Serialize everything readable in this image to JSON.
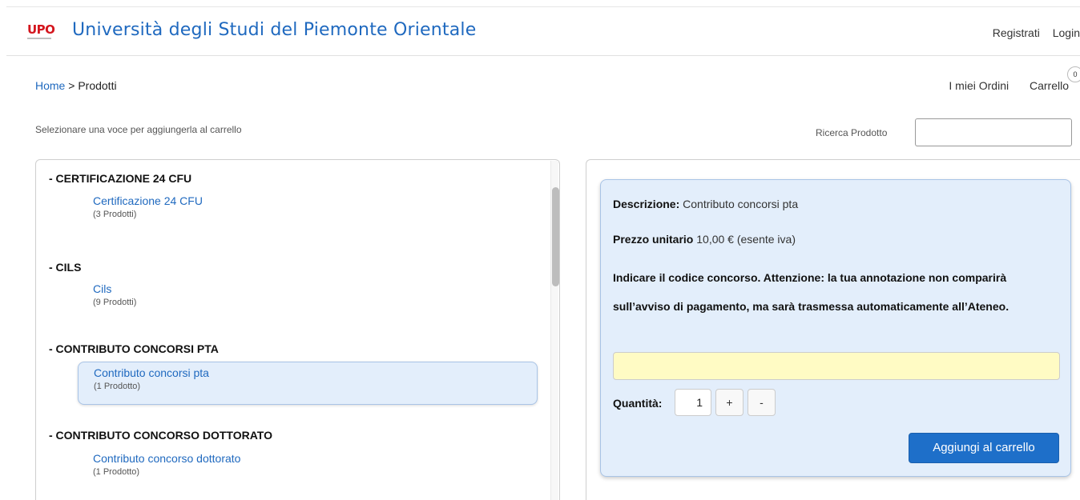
{
  "header": {
    "logo_text": "UPO",
    "site_title": "Università degli Studi del Piemonte Orientale",
    "register_label": "Registrati",
    "login_label": "Login"
  },
  "breadcrumb": {
    "home": "Home",
    "separator": " > ",
    "current": "Prodotti"
  },
  "user_nav": {
    "orders_label": "I miei Ordini",
    "cart_label": "Carrello",
    "cart_count": "0"
  },
  "instructions": "Selezionare una voce per aggiungerla al carrello",
  "search": {
    "label": "Ricerca Prodotto",
    "value": ""
  },
  "categories": [
    {
      "title": "- CERTIFICAZIONE 24 CFU",
      "product": "Certificazione 24 CFU",
      "count": "(3 Prodotti)"
    },
    {
      "title": "- CILS",
      "product": "Cils",
      "count": "(9 Prodotti)"
    },
    {
      "title": "- CONTRIBUTO CONCORSI PTA",
      "product": "Contributo concorsi pta",
      "count": "(1 Prodotto)"
    },
    {
      "title": "- CONTRIBUTO CONCORSO DOTTORATO",
      "product": "Contributo concorso dottorato",
      "count": "(1 Prodotto)"
    }
  ],
  "detail": {
    "description_label": "Descrizione:",
    "description_value": "Contributo concorsi pta",
    "price_label": "Prezzo unitario",
    "price_value": "10,00 € (esente iva)",
    "note": "Indicare il codice concorso. Attenzione: la tua annotazione non comparirà sull’avviso di pagamento, ma sarà trasmessa automaticamente all’Ateneo.",
    "note_value": "",
    "quantity_label": "Quantità:",
    "quantity_value": "1",
    "plus_label": "+",
    "minus_label": "-",
    "add_button_label": "Aggiungi al carrello"
  },
  "colors": {
    "link_blue": "#1f69bf",
    "brand_red": "#d4161e",
    "selected_bg": "#e3eefb",
    "note_input_bg": "#fffbc4",
    "primary_button": "#1e6fc9"
  }
}
